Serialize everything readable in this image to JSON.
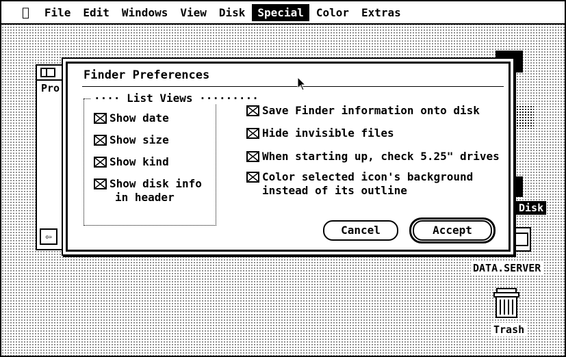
{
  "menubar": {
    "apple_icon": "apple-icon",
    "items": [
      "File",
      "Edit",
      "Windows",
      "View",
      "Disk",
      "Special",
      "Color",
      "Extras"
    ],
    "selected": "Special"
  },
  "background_window": {
    "label": "Pro"
  },
  "dialog": {
    "title": "Finder Preferences",
    "list_views": {
      "legend": "List Views",
      "options": [
        {
          "label": "Show date",
          "checked": true
        },
        {
          "label": "Show size",
          "checked": true
        },
        {
          "label": "Show kind",
          "checked": true
        },
        {
          "label_line1": "Show disk info",
          "label_line2": "in header",
          "checked": true
        }
      ]
    },
    "options": [
      {
        "label": "Save Finder information onto disk",
        "checked": true
      },
      {
        "label": "Hide invisible files",
        "checked": true
      },
      {
        "label": "When starting up, check 5.25\" drives",
        "checked": true
      },
      {
        "label_line1": "Color selected icon's background",
        "label_line2": "instead of its outline",
        "checked": true
      }
    ],
    "buttons": {
      "cancel": "Cancel",
      "accept": "Accept"
    }
  },
  "desktop": {
    "disk_label": "Disk",
    "server_label": "DATA.SERVER",
    "trash_label": "Trash"
  }
}
